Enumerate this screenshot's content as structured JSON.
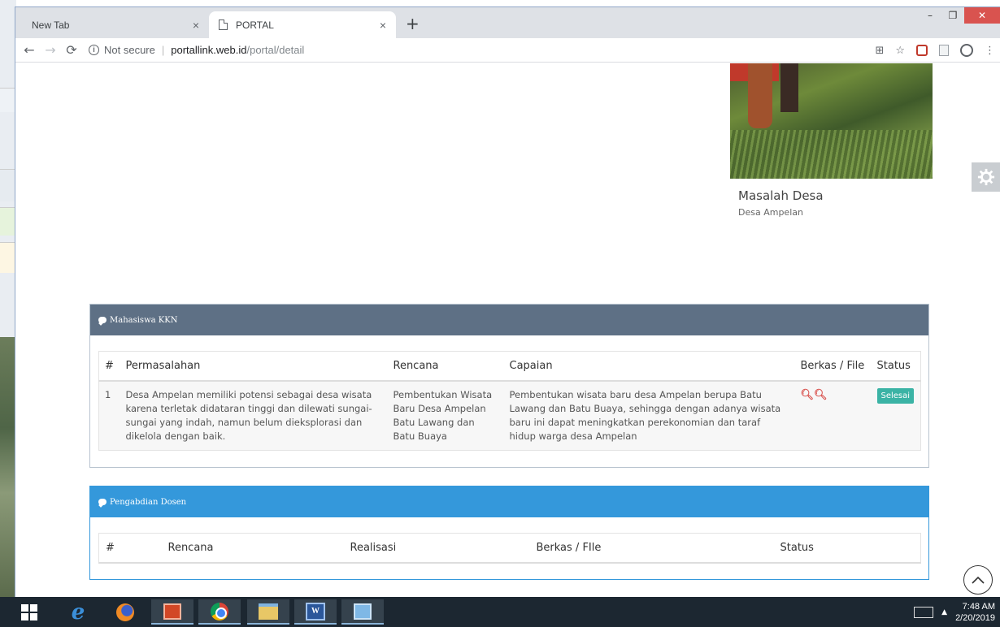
{
  "browser": {
    "tabs": [
      {
        "label": "New Tab"
      },
      {
        "label": "PORTAL"
      }
    ],
    "address": {
      "security": "Not secure",
      "host": "portallink.web.id",
      "path": "/portal/detail"
    }
  },
  "photo_card": {
    "title": "Masalah Desa",
    "subtitle": "Desa Ampelan"
  },
  "panel_mahasiswa": {
    "heading": "Mahasiswa KKN",
    "columns": {
      "num": "#",
      "permasalahan": "Permasalahan",
      "rencana": "Rencana",
      "capaian": "Capaian",
      "berkas": "Berkas / File",
      "status": "Status"
    },
    "rows": [
      {
        "num": "1",
        "permasalahan": "Desa Ampelan memiliki potensi sebagai desa wisata karena terletak didataran tinggi dan dilewati sungai-sungai yang indah, namun belum dieksplorasi dan dikelola dengan baik.",
        "rencana": "Pembentukan Wisata Baru Desa Ampelan Batu Lawang dan Batu Buaya",
        "capaian": "Pembentukan wisata baru desa Ampelan berupa Batu Lawang dan Batu Buaya, sehingga dengan adanya wisata baru ini dapat meningkatkan perekonomian dan taraf hidup warga desa Ampelan",
        "status": "Selesai"
      }
    ]
  },
  "panel_dosen": {
    "heading": "Pengabdian Dosen",
    "columns": {
      "num": "#",
      "rencana": "Rencana",
      "realisasi": "Realisasi",
      "berkas": "Berkas / FIle",
      "status": "Status"
    }
  },
  "taskbar": {
    "time": "7:48 AM",
    "date": "2/20/2019"
  },
  "colors": {
    "panel_mahasiswa_header": "#5e7085",
    "panel_dosen_header": "#3498db",
    "status_badge": "#3bb3a5",
    "file_icon": "#d9534f"
  }
}
